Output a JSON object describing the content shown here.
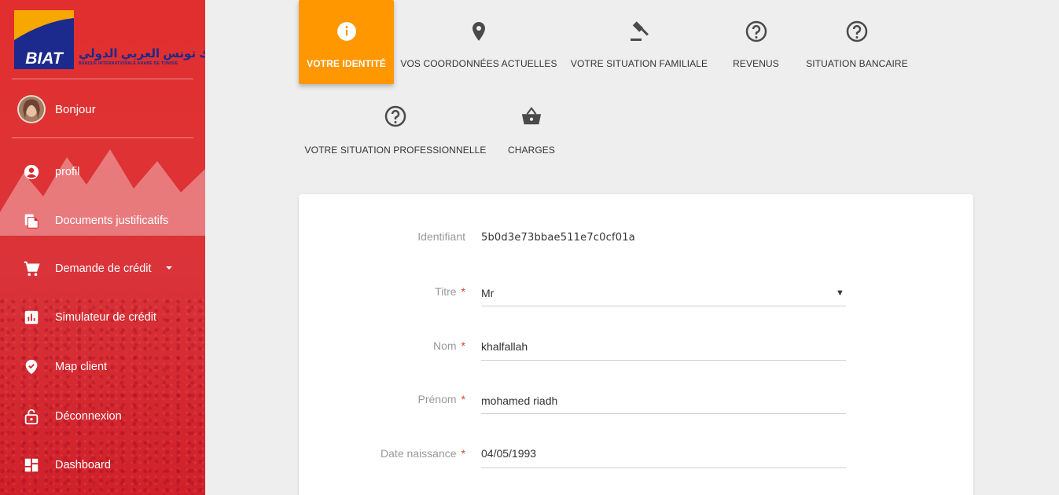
{
  "brand": {
    "logo_text": "BIAT",
    "arabic_name": "بنك تونس العربي الدولي",
    "subtitle": "BANQUE INTERNATIONALE ARABE DE TUNISIE",
    "colors": {
      "red": "#e12a2c",
      "orange": "#ff9800",
      "blue": "#1b2a8c",
      "yellow": "#f6a800"
    }
  },
  "user": {
    "greeting": "Bonjour"
  },
  "sidebar": {
    "items": [
      {
        "label": "profil",
        "icon": "account-circle-icon"
      },
      {
        "label": "Documents justificatifs",
        "icon": "documents-icon"
      },
      {
        "label": "Demande de crédit",
        "icon": "cart-icon",
        "has_dropdown": true
      },
      {
        "label": "Simulateur de crédit",
        "icon": "bar-chart-icon"
      },
      {
        "label": "Map client",
        "icon": "verified-pin-icon"
      },
      {
        "label": "Déconnexion",
        "icon": "lock-open-icon"
      },
      {
        "label": "Dashboard",
        "icon": "dashboard-icon"
      }
    ]
  },
  "steps": [
    {
      "label": "VOTRE IDENTITÉ",
      "icon": "info-icon",
      "active": true
    },
    {
      "label": "VOS COORDONNÉES ACTUELLES",
      "icon": "location-pin-icon",
      "active": false
    },
    {
      "label": "VOTRE SITUATION FAMILIALE",
      "icon": "gavel-icon",
      "active": false
    },
    {
      "label": "REVENUS",
      "icon": "help-circle-icon",
      "active": false
    },
    {
      "label": "SITUATION BANCAIRE",
      "icon": "help-circle-icon",
      "active": false
    },
    {
      "label": "VOTRE SITUATION PROFESSIONNELLE",
      "icon": "help-circle-icon",
      "active": false
    },
    {
      "label": "CHARGES",
      "icon": "basket-icon",
      "active": false
    }
  ],
  "form": {
    "identifiant": {
      "label": "Identifiant",
      "value": "5b0d3e73bbae511e7c0cf01a"
    },
    "titre": {
      "label": "Titre",
      "required": "*",
      "value": "Mr"
    },
    "nom": {
      "label": "Nom",
      "required": "*",
      "value": "khalfallah"
    },
    "prenom": {
      "label": "Prénom",
      "required": "*",
      "value": "mohamed riadh"
    },
    "date_naissance": {
      "label": "Date naissance",
      "required": "*",
      "value": "04/05/1993"
    }
  }
}
